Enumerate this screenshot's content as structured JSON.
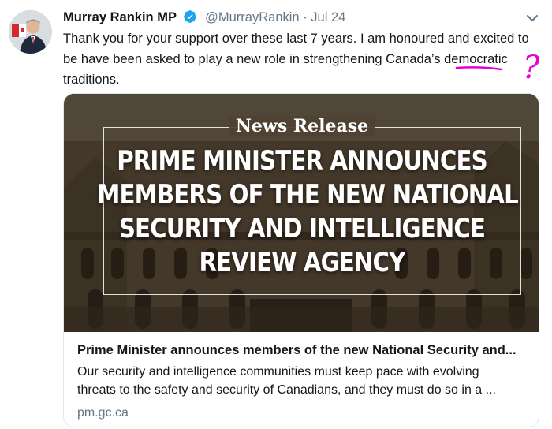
{
  "tweet": {
    "author_name": "Murray Rankin MP",
    "handle": "@MurrayRankin",
    "separator": "·",
    "date": "Jul 24",
    "verified_icon": "verified-badge-icon",
    "text_lines": [
      "Thank you for your support over these last 7 years.  I am honoured and excited to",
      "be have been asked to play a new role in strengthening Canada’s democratic",
      "traditions."
    ],
    "annotation_mark": "?"
  },
  "card": {
    "image": {
      "news_release": "News Release",
      "headline_lines": [
        "PRIME MINISTER ANNOUNCES",
        "MEMBERS OF THE NEW NATIONAL",
        "SECURITY AND INTELLIGENCE",
        "REVIEW AGENCY"
      ]
    },
    "title": "Prime Minister announces members of the new National Security and...",
    "description_lines": [
      "Our security and intelligence communities must keep pace with evolving",
      "threats to the safety and security of Canadians, and they must do so in a ..."
    ],
    "domain": "pm.gc.ca"
  },
  "colors": {
    "verified": "#1da1f2",
    "secondary_text": "#657786",
    "annotation": "#e600d6"
  }
}
